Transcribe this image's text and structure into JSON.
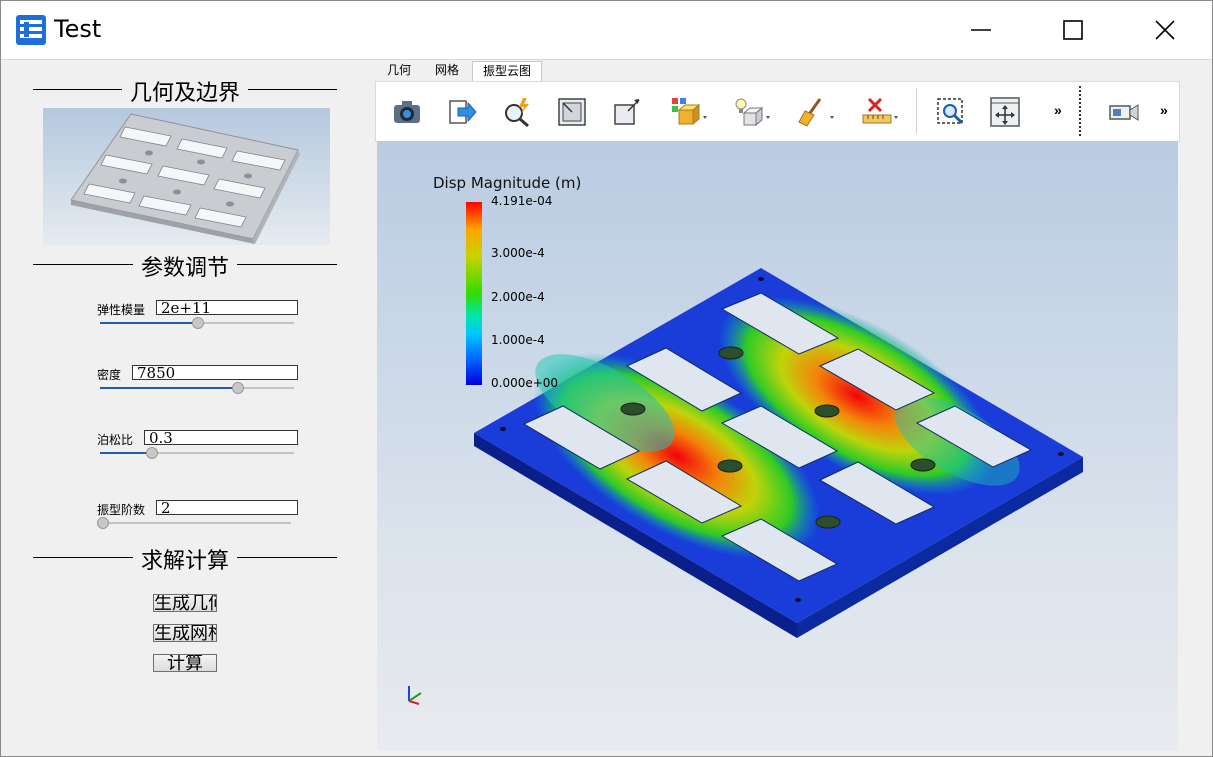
{
  "window": {
    "title": "Test"
  },
  "left_panel": {
    "sections": {
      "geometry": "几何及边界",
      "params": "参数调节",
      "solve": "求解计算"
    },
    "params": [
      {
        "label": "弹性模量",
        "value": "2e+11",
        "slider_fraction": 0.5
      },
      {
        "label": "密度",
        "value": "7850",
        "slider_fraction": 0.72
      },
      {
        "label": "泊松比",
        "value": "0.3",
        "slider_fraction": 0.25
      },
      {
        "label": "振型阶数",
        "value": "2",
        "slider_fraction": 0.0
      }
    ],
    "buttons": {
      "gen_geometry": "生成几何",
      "gen_mesh": "生成网格",
      "compute": "计算"
    }
  },
  "tabs": [
    {
      "label": "几何",
      "active": false
    },
    {
      "label": "网格",
      "active": false
    },
    {
      "label": "振型云图",
      "active": true
    }
  ],
  "toolbar": {
    "icons": [
      "camera-icon",
      "export-icon",
      "zoom-interact-icon",
      "reset-view-icon",
      "rotate-view-icon",
      "color-cube-icon",
      "light-bulb-icon",
      "clean-brush-icon",
      "ruler-icon",
      "zoom-box-icon",
      "fit-view-icon",
      "camera-record-icon"
    ],
    "overflow": "»"
  },
  "legend": {
    "title": "Disp Magnitude (m)",
    "ticks": [
      "4.191e-04",
      "3.000e-4",
      "2.000e-4",
      "1.000e-4",
      "0.000e+00"
    ]
  },
  "colors": {
    "accent": "#1c5fa8",
    "high": "#ff0000",
    "low": "#0000dc"
  }
}
